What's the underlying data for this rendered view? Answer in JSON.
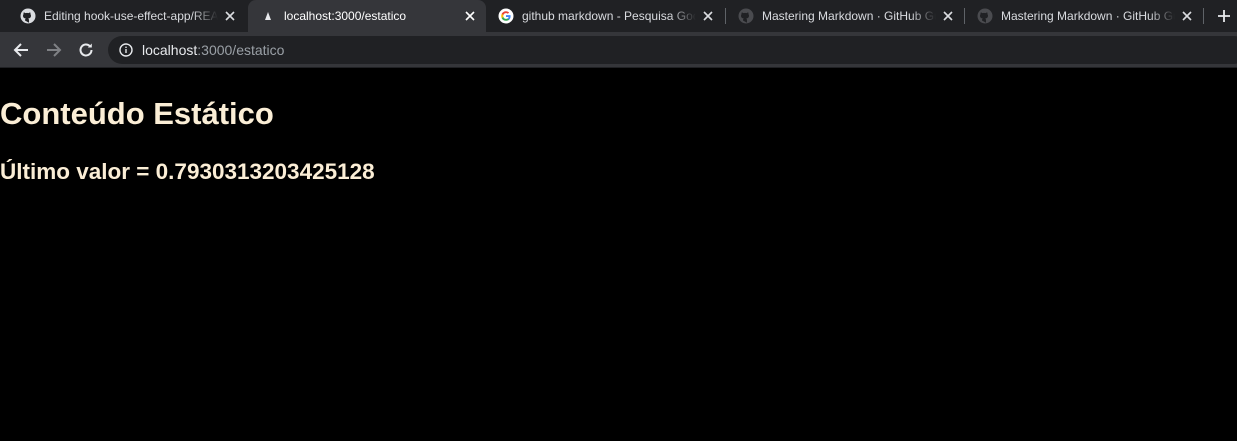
{
  "tabs": [
    {
      "title": "Editing hook-use-effect-app/README.md",
      "icon": "github-icon",
      "active": false
    },
    {
      "title": "localhost:3000/estatico",
      "icon": "react-icon",
      "active": true
    },
    {
      "title": "github markdown - Pesquisa Google",
      "icon": "google-icon",
      "active": false
    },
    {
      "title": "Mastering Markdown · GitHub Guides",
      "icon": "github-icon",
      "active": false
    },
    {
      "title": "Mastering Markdown · GitHub Guides",
      "icon": "github-icon",
      "active": false
    }
  ],
  "address_bar": {
    "host": "localhost",
    "path": ":3000/estatico"
  },
  "page": {
    "heading": "Conteúdo Estático",
    "subheading": "Último valor = 0.7930313203425128"
  },
  "colors": {
    "tabstrip": "#202124",
    "toolbar": "#35363a",
    "page_bg": "#000000",
    "heading_text": "#fbeed6"
  }
}
